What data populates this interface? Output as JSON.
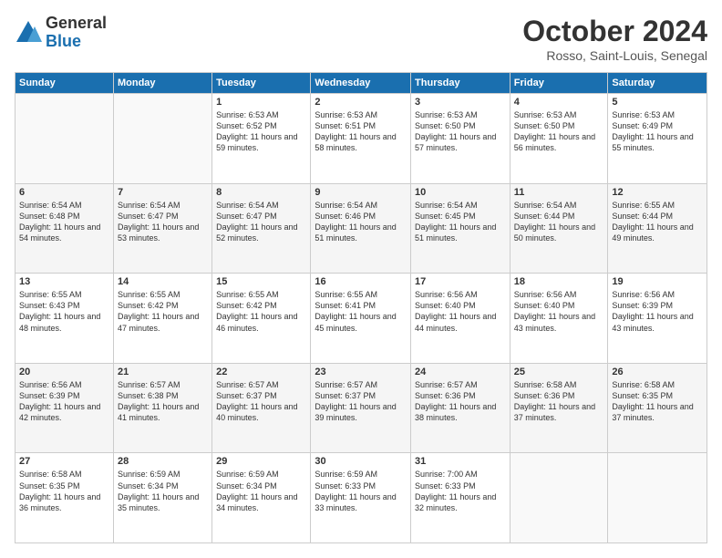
{
  "logo": {
    "general": "General",
    "blue": "Blue"
  },
  "title": "October 2024",
  "location": "Rosso, Saint-Louis, Senegal",
  "days_of_week": [
    "Sunday",
    "Monday",
    "Tuesday",
    "Wednesday",
    "Thursday",
    "Friday",
    "Saturday"
  ],
  "weeks": [
    [
      {
        "day": "",
        "content": ""
      },
      {
        "day": "",
        "content": ""
      },
      {
        "day": "1",
        "content": "Sunrise: 6:53 AM\nSunset: 6:52 PM\nDaylight: 11 hours and 59 minutes."
      },
      {
        "day": "2",
        "content": "Sunrise: 6:53 AM\nSunset: 6:51 PM\nDaylight: 11 hours and 58 minutes."
      },
      {
        "day": "3",
        "content": "Sunrise: 6:53 AM\nSunset: 6:50 PM\nDaylight: 11 hours and 57 minutes."
      },
      {
        "day": "4",
        "content": "Sunrise: 6:53 AM\nSunset: 6:50 PM\nDaylight: 11 hours and 56 minutes."
      },
      {
        "day": "5",
        "content": "Sunrise: 6:53 AM\nSunset: 6:49 PM\nDaylight: 11 hours and 55 minutes."
      }
    ],
    [
      {
        "day": "6",
        "content": "Sunrise: 6:54 AM\nSunset: 6:48 PM\nDaylight: 11 hours and 54 minutes."
      },
      {
        "day": "7",
        "content": "Sunrise: 6:54 AM\nSunset: 6:47 PM\nDaylight: 11 hours and 53 minutes."
      },
      {
        "day": "8",
        "content": "Sunrise: 6:54 AM\nSunset: 6:47 PM\nDaylight: 11 hours and 52 minutes."
      },
      {
        "day": "9",
        "content": "Sunrise: 6:54 AM\nSunset: 6:46 PM\nDaylight: 11 hours and 51 minutes."
      },
      {
        "day": "10",
        "content": "Sunrise: 6:54 AM\nSunset: 6:45 PM\nDaylight: 11 hours and 51 minutes."
      },
      {
        "day": "11",
        "content": "Sunrise: 6:54 AM\nSunset: 6:44 PM\nDaylight: 11 hours and 50 minutes."
      },
      {
        "day": "12",
        "content": "Sunrise: 6:55 AM\nSunset: 6:44 PM\nDaylight: 11 hours and 49 minutes."
      }
    ],
    [
      {
        "day": "13",
        "content": "Sunrise: 6:55 AM\nSunset: 6:43 PM\nDaylight: 11 hours and 48 minutes."
      },
      {
        "day": "14",
        "content": "Sunrise: 6:55 AM\nSunset: 6:42 PM\nDaylight: 11 hours and 47 minutes."
      },
      {
        "day": "15",
        "content": "Sunrise: 6:55 AM\nSunset: 6:42 PM\nDaylight: 11 hours and 46 minutes."
      },
      {
        "day": "16",
        "content": "Sunrise: 6:55 AM\nSunset: 6:41 PM\nDaylight: 11 hours and 45 minutes."
      },
      {
        "day": "17",
        "content": "Sunrise: 6:56 AM\nSunset: 6:40 PM\nDaylight: 11 hours and 44 minutes."
      },
      {
        "day": "18",
        "content": "Sunrise: 6:56 AM\nSunset: 6:40 PM\nDaylight: 11 hours and 43 minutes."
      },
      {
        "day": "19",
        "content": "Sunrise: 6:56 AM\nSunset: 6:39 PM\nDaylight: 11 hours and 43 minutes."
      }
    ],
    [
      {
        "day": "20",
        "content": "Sunrise: 6:56 AM\nSunset: 6:39 PM\nDaylight: 11 hours and 42 minutes."
      },
      {
        "day": "21",
        "content": "Sunrise: 6:57 AM\nSunset: 6:38 PM\nDaylight: 11 hours and 41 minutes."
      },
      {
        "day": "22",
        "content": "Sunrise: 6:57 AM\nSunset: 6:37 PM\nDaylight: 11 hours and 40 minutes."
      },
      {
        "day": "23",
        "content": "Sunrise: 6:57 AM\nSunset: 6:37 PM\nDaylight: 11 hours and 39 minutes."
      },
      {
        "day": "24",
        "content": "Sunrise: 6:57 AM\nSunset: 6:36 PM\nDaylight: 11 hours and 38 minutes."
      },
      {
        "day": "25",
        "content": "Sunrise: 6:58 AM\nSunset: 6:36 PM\nDaylight: 11 hours and 37 minutes."
      },
      {
        "day": "26",
        "content": "Sunrise: 6:58 AM\nSunset: 6:35 PM\nDaylight: 11 hours and 37 minutes."
      }
    ],
    [
      {
        "day": "27",
        "content": "Sunrise: 6:58 AM\nSunset: 6:35 PM\nDaylight: 11 hours and 36 minutes."
      },
      {
        "day": "28",
        "content": "Sunrise: 6:59 AM\nSunset: 6:34 PM\nDaylight: 11 hours and 35 minutes."
      },
      {
        "day": "29",
        "content": "Sunrise: 6:59 AM\nSunset: 6:34 PM\nDaylight: 11 hours and 34 minutes."
      },
      {
        "day": "30",
        "content": "Sunrise: 6:59 AM\nSunset: 6:33 PM\nDaylight: 11 hours and 33 minutes."
      },
      {
        "day": "31",
        "content": "Sunrise: 7:00 AM\nSunset: 6:33 PM\nDaylight: 11 hours and 32 minutes."
      },
      {
        "day": "",
        "content": ""
      },
      {
        "day": "",
        "content": ""
      }
    ]
  ]
}
